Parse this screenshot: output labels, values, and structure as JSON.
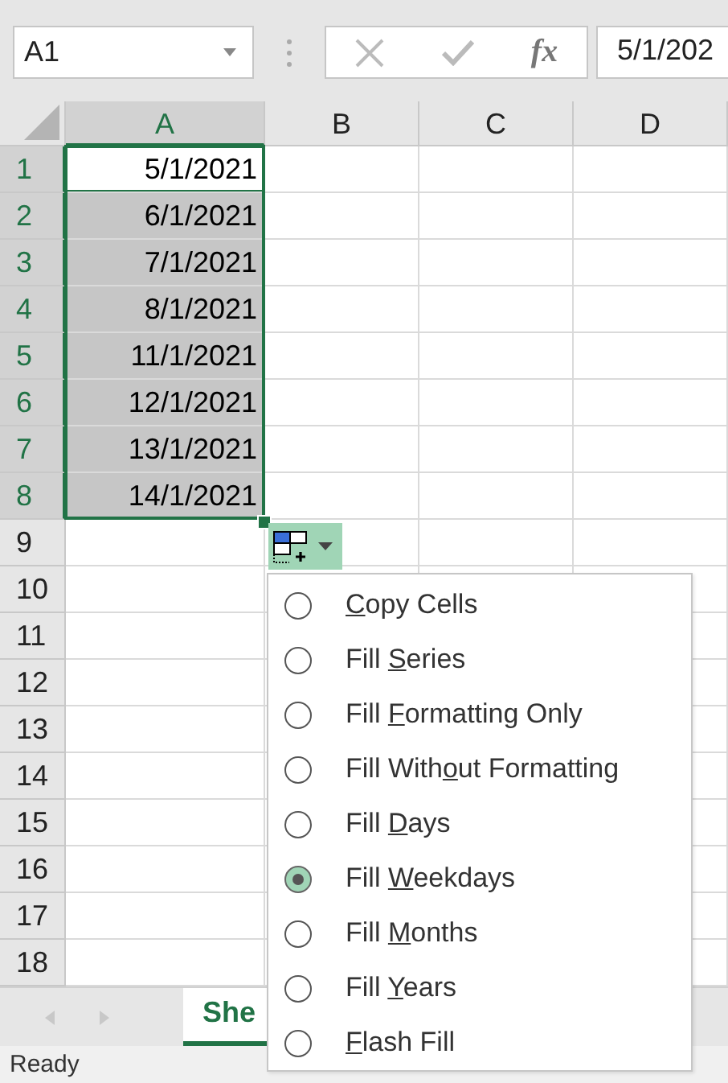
{
  "name_box": {
    "value": "A1"
  },
  "formula_bar": {
    "function_label": "fx",
    "value": "5/1/202"
  },
  "columns": [
    {
      "label": "A",
      "selected": true
    },
    {
      "label": "B",
      "selected": false
    },
    {
      "label": "C",
      "selected": false
    },
    {
      "label": "D",
      "selected": false
    }
  ],
  "rows": [
    {
      "label": "1",
      "selected": true,
      "active": true,
      "cells": [
        "5/1/2021"
      ]
    },
    {
      "label": "2",
      "selected": true,
      "active": false,
      "cells": [
        "6/1/2021"
      ]
    },
    {
      "label": "3",
      "selected": true,
      "active": false,
      "cells": [
        "7/1/2021"
      ]
    },
    {
      "label": "4",
      "selected": true,
      "active": false,
      "cells": [
        "8/1/2021"
      ]
    },
    {
      "label": "5",
      "selected": true,
      "active": false,
      "cells": [
        "11/1/2021"
      ]
    },
    {
      "label": "6",
      "selected": true,
      "active": false,
      "cells": [
        "12/1/2021"
      ]
    },
    {
      "label": "7",
      "selected": true,
      "active": false,
      "cells": [
        "13/1/2021"
      ]
    },
    {
      "label": "8",
      "selected": true,
      "active": false,
      "cells": [
        "14/1/2021"
      ]
    },
    {
      "label": "9",
      "selected": false,
      "active": false,
      "cells": []
    },
    {
      "label": "10",
      "selected": false,
      "active": false,
      "cells": []
    },
    {
      "label": "11",
      "selected": false,
      "active": false,
      "cells": []
    },
    {
      "label": "12",
      "selected": false,
      "active": false,
      "cells": []
    },
    {
      "label": "13",
      "selected": false,
      "active": false,
      "cells": []
    },
    {
      "label": "14",
      "selected": false,
      "active": false,
      "cells": []
    },
    {
      "label": "15",
      "selected": false,
      "active": false,
      "cells": []
    },
    {
      "label": "16",
      "selected": false,
      "active": false,
      "cells": []
    },
    {
      "label": "17",
      "selected": false,
      "active": false,
      "cells": []
    },
    {
      "label": "18",
      "selected": false,
      "active": false,
      "cells": []
    }
  ],
  "autofill_menu": {
    "items": [
      {
        "key": "C",
        "after": "opy Cells",
        "selected": false
      },
      {
        "before": "Fill ",
        "key": "S",
        "after": "eries",
        "selected": false
      },
      {
        "before": "Fill ",
        "key": "F",
        "after": "ormatting Only",
        "selected": false
      },
      {
        "before": "Fill With",
        "key": "o",
        "after": "ut Formatting",
        "selected": false
      },
      {
        "before": "Fill ",
        "key": "D",
        "after": "ays",
        "selected": false
      },
      {
        "before": "Fill ",
        "key": "W",
        "after": "eekdays",
        "selected": true
      },
      {
        "before": "Fill ",
        "key": "M",
        "after": "onths",
        "selected": false
      },
      {
        "before": "Fill ",
        "key": "Y",
        "after": "ears",
        "selected": false
      },
      {
        "key": "F",
        "after": "lash Fill",
        "selected": false
      }
    ]
  },
  "sheet_tabs": [
    {
      "label": "She",
      "selected": true
    }
  ],
  "status_bar": {
    "text": "Ready"
  }
}
